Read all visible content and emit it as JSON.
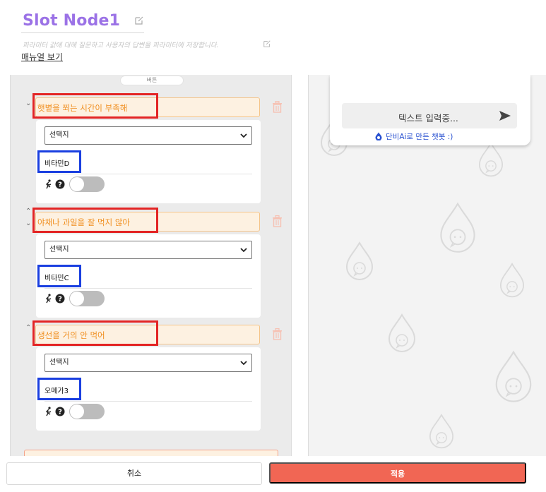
{
  "header": {
    "title": "Slot Node1",
    "subtitle": "파라미터 값에 대해 질문하고 사용자의 답변을 파라미터에 저장합니다.",
    "manual_link": "매뉴얼 보기"
  },
  "left": {
    "pill_label": "버튼",
    "items": [
      {
        "question": "햇볕을 쬐는 시간이 부족해",
        "select_value": "선택지",
        "answer": "비타민D"
      },
      {
        "question": "야채나 과일을 잘 먹지 않아",
        "select_value": "선택지",
        "answer": "비타민C"
      },
      {
        "question": "생선을 거의 안 먹어",
        "select_value": "선택지",
        "answer": "오메가3"
      }
    ]
  },
  "preview": {
    "input_placeholder": "텍스트 입력중...",
    "brand_text": "단비Ai로 만든 챗봇 :)"
  },
  "footer": {
    "cancel_label": "취소",
    "apply_label": "적용"
  },
  "colors": {
    "title": "#9b72e6",
    "question_text": "#f08e1e",
    "question_bg": "#fdf1e1",
    "highlight_red": "#e32424",
    "highlight_blue": "#1a3fe0",
    "apply": "#f16654",
    "brand": "#2a52d1"
  }
}
